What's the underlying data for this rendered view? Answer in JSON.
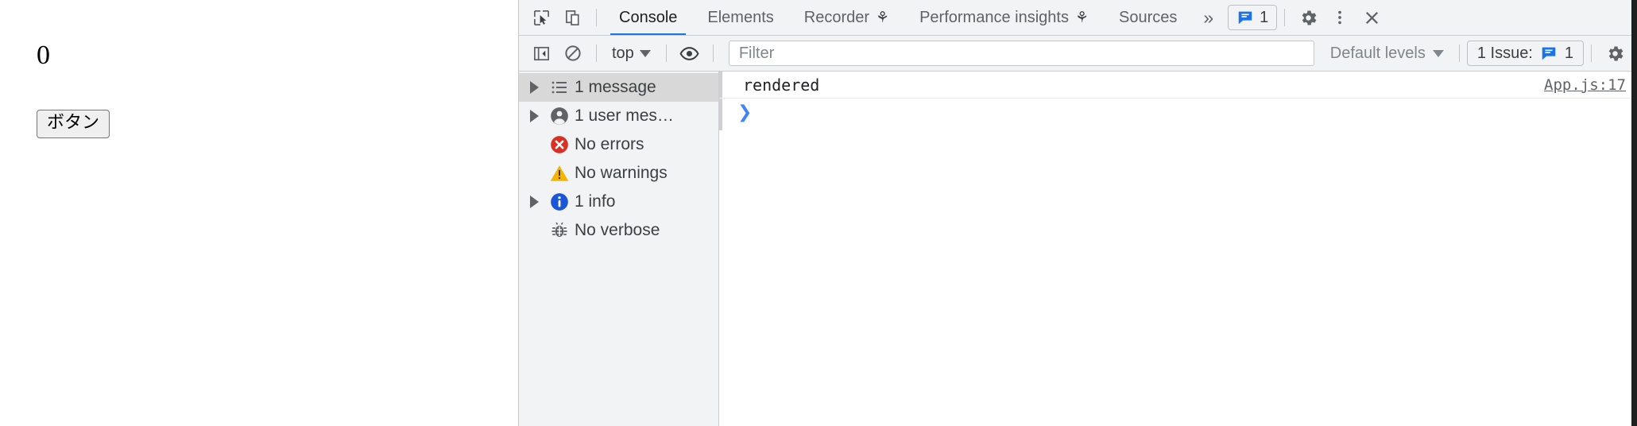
{
  "page": {
    "counter": "0",
    "button_label": "ボタン"
  },
  "devtools": {
    "toolbar": {
      "inspect_icon": "inspect-cursor-icon",
      "device_icon": "device-toolbar-icon",
      "tabs": [
        {
          "label": "Console",
          "selected": true,
          "badge": ""
        },
        {
          "label": "Elements",
          "selected": false,
          "badge": ""
        },
        {
          "label": "Recorder",
          "selected": false,
          "badge": "flask-icon"
        },
        {
          "label": "Performance insights",
          "selected": false,
          "badge": "flask-icon"
        },
        {
          "label": "Sources",
          "selected": false,
          "badge": ""
        }
      ],
      "more_tabs": "»",
      "issues_badge_count": "1",
      "issues_badge_icon": "issues-message-icon",
      "settings_icon": "gear-icon",
      "more_options_icon": "kebab-menu-icon",
      "close_icon": "close-icon"
    },
    "filterbar": {
      "sidebar_toggle_icon": "console-sidebar-toggle-icon",
      "clear_console_icon": "clear-console-icon",
      "context_value": "top",
      "eye_icon": "live-expression-icon",
      "filter_value": "",
      "filter_placeholder": "Filter",
      "levels_label": "Default levels",
      "issue_label": "1 Issue:",
      "issue_count": "1",
      "issue_icon": "issues-message-icon",
      "settings_icon": "gear-icon"
    },
    "sidebar": {
      "items": [
        {
          "label": "1 message",
          "icon": "list-icon",
          "expandable": true,
          "selected": true
        },
        {
          "label": "1 user mes…",
          "icon": "user-icon",
          "expandable": true,
          "selected": false
        },
        {
          "label": "No errors",
          "icon": "error-icon",
          "expandable": false,
          "selected": false
        },
        {
          "label": "No warnings",
          "icon": "warning-icon",
          "expandable": false,
          "selected": false
        },
        {
          "label": "1 info",
          "icon": "info-icon",
          "expandable": true,
          "selected": false
        },
        {
          "label": "No verbose",
          "icon": "bug-icon",
          "expandable": false,
          "selected": false
        }
      ]
    },
    "console": {
      "messages": [
        {
          "text": "rendered",
          "source": "App.js:17"
        }
      ],
      "prompt_caret": "❯"
    }
  },
  "colors": {
    "accent": "#1a73e8",
    "prompt": "#4285f4",
    "error": "#d93025",
    "warning": "#f5b400",
    "info": "#1a56d6",
    "toolbar_bg": "#f1f3f4",
    "selected_row": "#d8d8d8"
  }
}
